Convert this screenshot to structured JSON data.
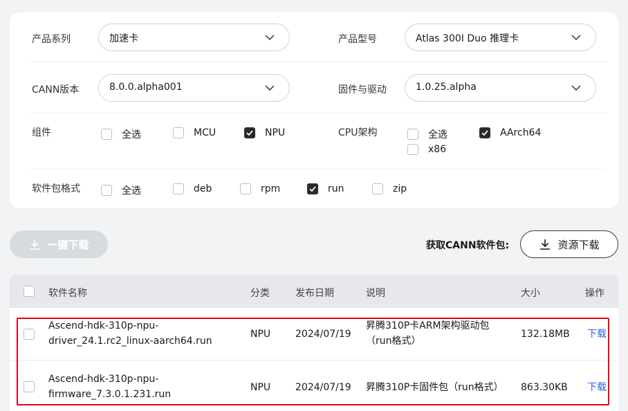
{
  "filters": {
    "product_series": {
      "label": "产品系列",
      "value": "加速卡"
    },
    "product_model": {
      "label": "产品型号",
      "value": "Atlas 300I Duo 推理卡"
    },
    "cann_version": {
      "label": "CANN版本",
      "value": "8.0.0.alpha001"
    },
    "firmware_driver": {
      "label": "固件与驱动",
      "value": "1.0.25.alpha"
    },
    "components": {
      "label": "组件",
      "options": [
        {
          "label": "全选",
          "checked": false
        },
        {
          "label": "MCU",
          "checked": false
        },
        {
          "label": "NPU",
          "checked": true
        }
      ]
    },
    "cpu_arch": {
      "label": "CPU架构",
      "options": [
        {
          "label": "全选",
          "checked": false
        },
        {
          "label": "AArch64",
          "checked": true
        },
        {
          "label": "x86",
          "checked": false
        }
      ]
    },
    "package_format": {
      "label": "软件包格式",
      "options": [
        {
          "label": "全选",
          "checked": false
        },
        {
          "label": "deb",
          "checked": false
        },
        {
          "label": "rpm",
          "checked": false
        },
        {
          "label": "run",
          "checked": true
        },
        {
          "label": "zip",
          "checked": false
        }
      ]
    }
  },
  "actions": {
    "one_click_download": "一键下载",
    "get_cann_label": "获取CANN软件包:",
    "resource_download": "资源下载"
  },
  "table": {
    "headers": {
      "name": "软件名称",
      "category": "分类",
      "date": "发布日期",
      "desc": "说明",
      "size": "大小",
      "action": "操作"
    },
    "rows": [
      {
        "name_line1": "Ascend-hdk-310p-npu-",
        "name_line2": "driver_24.1.rc2_linux-aarch64.run",
        "category": "NPU",
        "date": "2024/07/19",
        "desc_line1": "昇腾310P卡ARM架构驱动包",
        "desc_line2": "（run格式）",
        "size": "132.18MB",
        "action": "下载"
      },
      {
        "name_line1": "Ascend-hdk-310p-npu-",
        "name_line2": "firmware_7.3.0.1.231.run",
        "category": "NPU",
        "date": "2024/07/19",
        "desc_line1": "昇腾310P卡固件包（run格式）",
        "size": "863.30KB",
        "action": "下载"
      }
    ]
  },
  "colors": {
    "link": "#2e63e0",
    "highlight": "#e60012",
    "checked": "#2a2a2a"
  }
}
